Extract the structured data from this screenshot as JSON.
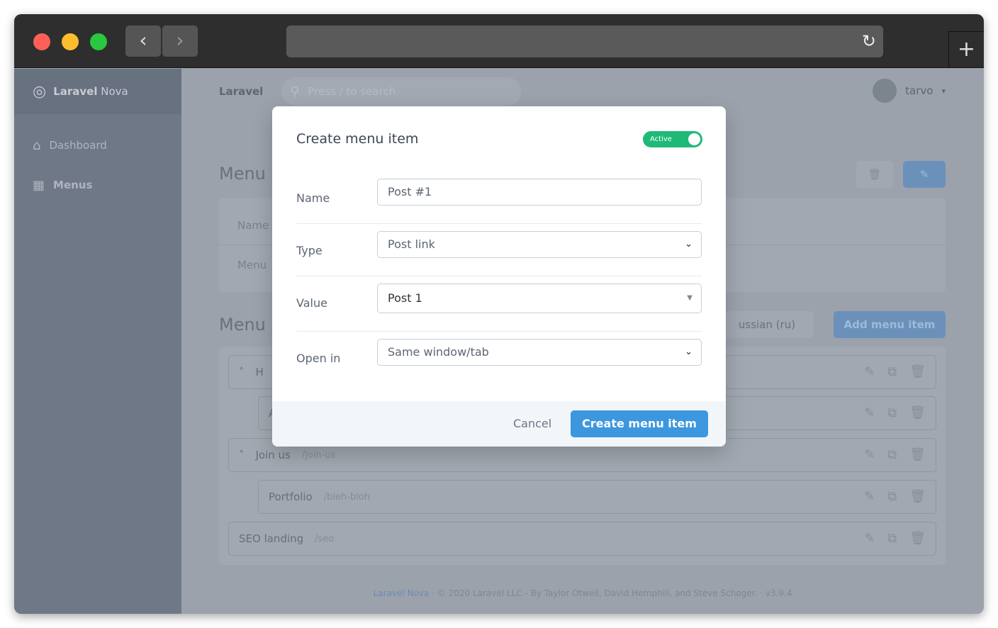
{
  "browser": {
    "back": "‹",
    "forward": "›",
    "reload": "↻",
    "new_tab": "+"
  },
  "app": {
    "brand_bold": "Laravel",
    "brand_light": "Nova",
    "breadcrumb": "Laravel",
    "search_placeholder": "Press / to search",
    "user": "tarvo"
  },
  "sidebar": {
    "items": [
      {
        "label": "Dashboard",
        "icon": "home-icon"
      },
      {
        "label": "Menus",
        "icon": "grid-icon"
      }
    ]
  },
  "background": {
    "title1": "Menu I",
    "field1": "Name",
    "field2": "Menu",
    "title2": "Menu i",
    "locale": "ussian (ru)",
    "add_button": "Add menu item",
    "rows": [
      {
        "name": "H",
        "path": ""
      },
      {
        "name": "A",
        "path": ""
      },
      {
        "name": "Join us",
        "path": "/join-us"
      },
      {
        "name": "Portfolio",
        "path": "/bleh-bloh"
      },
      {
        "name": "SEO landing",
        "path": "/seo"
      }
    ],
    "footer_link": "Laravel Nova",
    "footer_text": "· © 2020 Laravel LLC - By Taylor Otwell, David Hemphill, and Steve Schoger. · v3.9.4"
  },
  "modal": {
    "title": "Create menu item",
    "toggle_label": "Active",
    "toggle_on": true,
    "fields": [
      {
        "label": "Name",
        "value": "Post #1"
      },
      {
        "label": "Type",
        "value": "Post link"
      },
      {
        "label": "Value",
        "value": "Post 1"
      },
      {
        "label": "Open in",
        "value": "Same window/tab"
      }
    ],
    "cancel": "Cancel",
    "submit": "Create menu item"
  },
  "colors": {
    "primary": "#3d97de",
    "toggle": "#21b978"
  }
}
